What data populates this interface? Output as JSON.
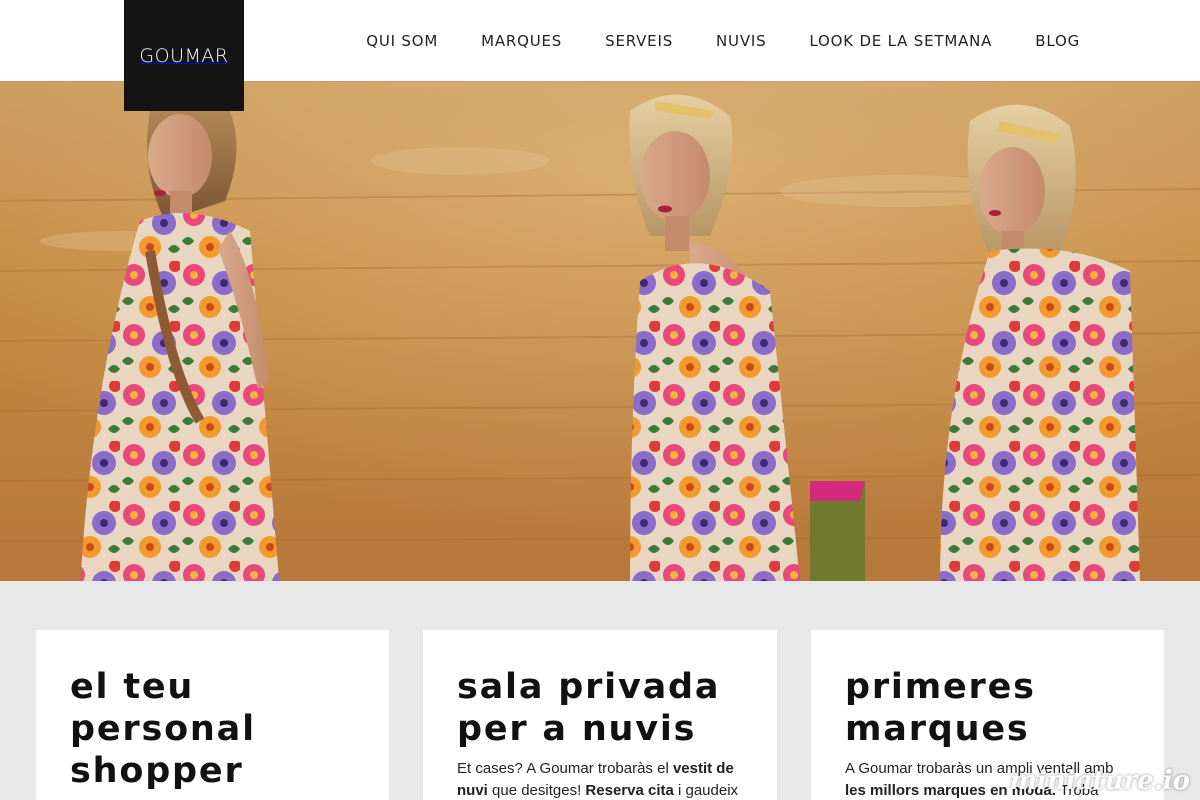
{
  "brand": {
    "logo_text": "GOUMAR"
  },
  "nav": {
    "items": [
      {
        "label": "QUI SOM"
      },
      {
        "label": "MARQUES"
      },
      {
        "label": "SERVEIS"
      },
      {
        "label": "NUVIS"
      },
      {
        "label": "LOOK DE LA SETMANA"
      },
      {
        "label": "BLOG"
      }
    ]
  },
  "hero": {
    "image": "hero-photo"
  },
  "cards": [
    {
      "title": "el teu personal shopper",
      "text": []
    },
    {
      "title": "sala privada per a nuvis",
      "text": [
        {
          "t": "Et cases? A Goumar trobaràs el ",
          "b": false
        },
        {
          "t": "vestit de nuvi",
          "b": true
        },
        {
          "t": " que desitges! ",
          "b": false
        },
        {
          "t": "Reserva cita",
          "b": true
        },
        {
          "t": " i gaudeix",
          "b": false
        }
      ]
    },
    {
      "title": "primeres marques",
      "text": [
        {
          "t": "A Goumar trobaràs un ampli ventall amb ",
          "b": false
        },
        {
          "t": "les millors marques en moda.",
          "b": true
        },
        {
          "t": " Troba",
          "b": false
        }
      ]
    }
  ],
  "watermark": "miniature.io",
  "colors": {
    "header_bg": "#ffffff",
    "logo_bg": "#141414",
    "page_bg": "#e8e8e8"
  }
}
